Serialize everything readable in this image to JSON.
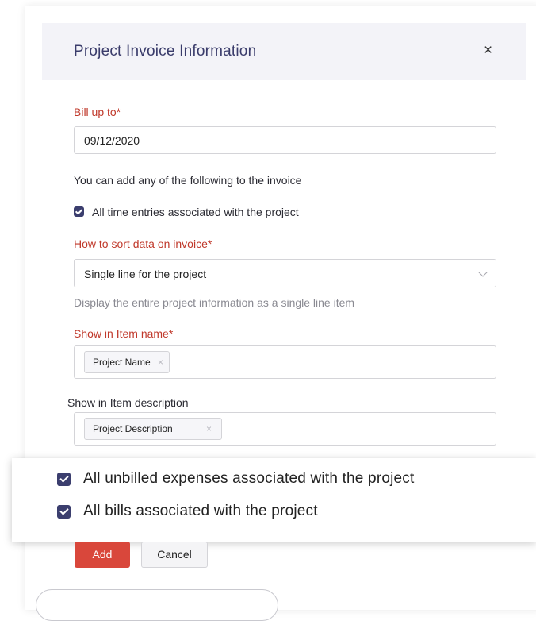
{
  "modal": {
    "title": "Project Invoice Information",
    "close_glyph": "×"
  },
  "bill_up_to": {
    "label": "Bill up to*",
    "value": "09/12/2020"
  },
  "add_intro": "You can add any of the following to the invoice",
  "time_entries": {
    "label": "All time entries associated with the project",
    "checked": true
  },
  "sort": {
    "label": "How to sort data on invoice*",
    "selected": "Single line for the project",
    "hint": "Display the entire project information as a single line item"
  },
  "item_name": {
    "label": "Show in Item name*",
    "tags": [
      {
        "label": "Project Name",
        "remove": "×"
      }
    ]
  },
  "item_description": {
    "label": "Show in Item description",
    "tags": [
      {
        "label": "Project Description",
        "remove": "×"
      }
    ]
  },
  "zoom_options": [
    {
      "label": "All unbilled expenses associated with the project",
      "checked": true
    },
    {
      "label": "All bills associated with the project",
      "checked": true
    }
  ],
  "actions": {
    "add_label": "Add",
    "cancel_label": "Cancel"
  },
  "colors": {
    "accent": "#3b3e6e",
    "required": "#c0392b",
    "primary_button": "#d9473b",
    "header_bg": "#f3f3f8"
  }
}
